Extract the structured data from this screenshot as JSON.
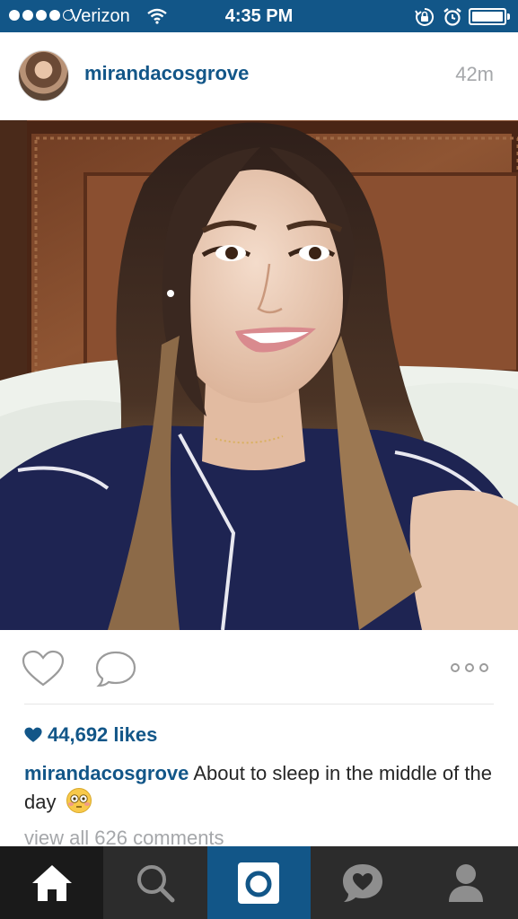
{
  "status_bar": {
    "carrier": "Verizon",
    "time": "4:35 PM",
    "signal_bars": 4,
    "battery_level": 1.0
  },
  "post": {
    "username": "mirandacosgrove",
    "time_ago": "42m",
    "likes": "44,692 likes",
    "caption_user": "mirandacosgrove",
    "caption_text": "About to sleep in the middle of the day",
    "caption_emoji": "flushed-face-emoji",
    "view_comments": "view all 626 comments"
  },
  "tabs": [
    {
      "name": "home",
      "icon": "home-icon",
      "active": true
    },
    {
      "name": "explore",
      "icon": "search-icon",
      "active": false
    },
    {
      "name": "camera",
      "icon": "camera-icon",
      "active": false
    },
    {
      "name": "activity",
      "icon": "heart-bubble-icon",
      "active": false
    },
    {
      "name": "profile",
      "icon": "profile-icon",
      "active": false
    }
  ],
  "colors": {
    "brand_blue": "#125688",
    "text_gray": "#a5a7aa",
    "tab_bar": "#2c2c2c"
  }
}
